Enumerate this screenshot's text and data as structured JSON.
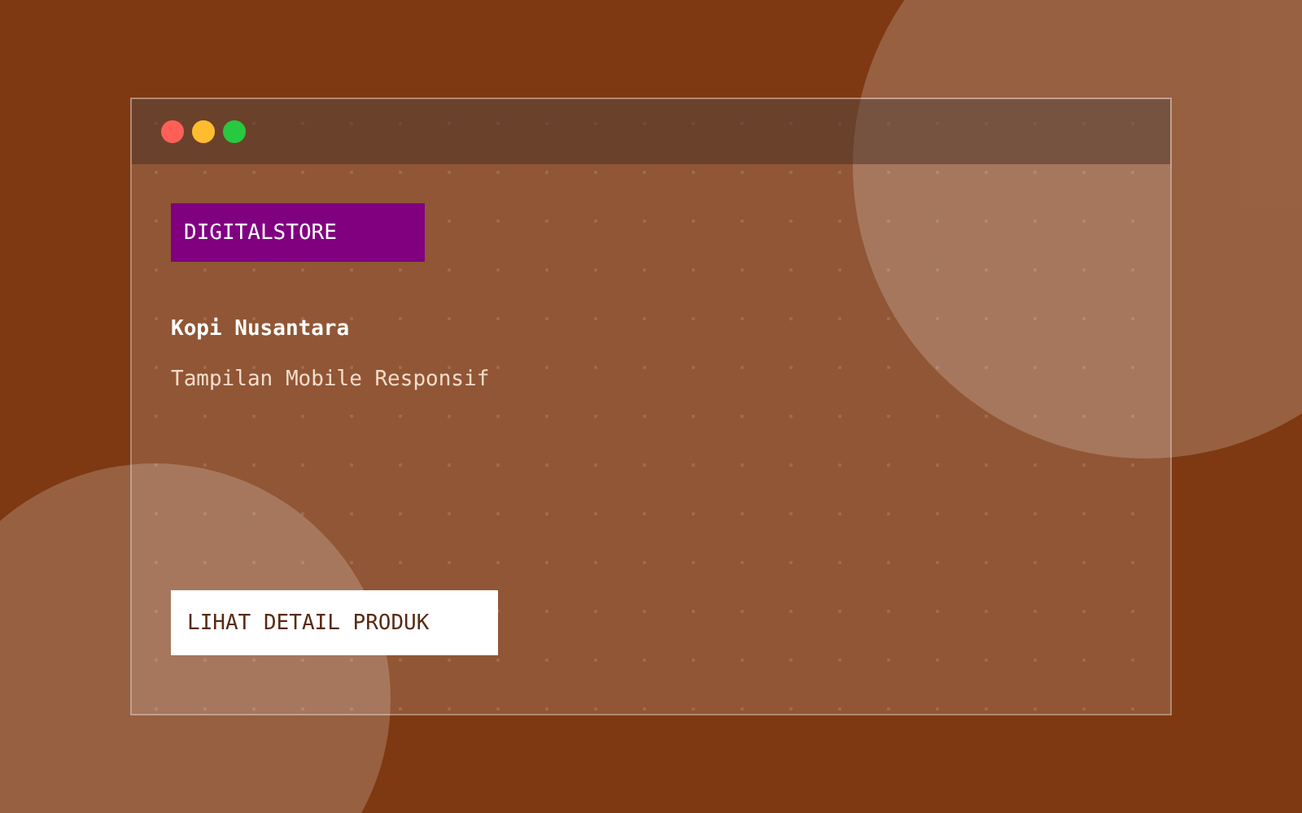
{
  "window": {
    "controls": [
      {
        "color": "#ff5f57"
      },
      {
        "color": "#febc2e"
      },
      {
        "color": "#28c840"
      }
    ]
  },
  "badge": "DIGITALSTORE",
  "title": "Kopi Nusantara",
  "subtitle": "Tampilan Mobile Responsif",
  "button": "LIHAT DETAIL PRODUK"
}
